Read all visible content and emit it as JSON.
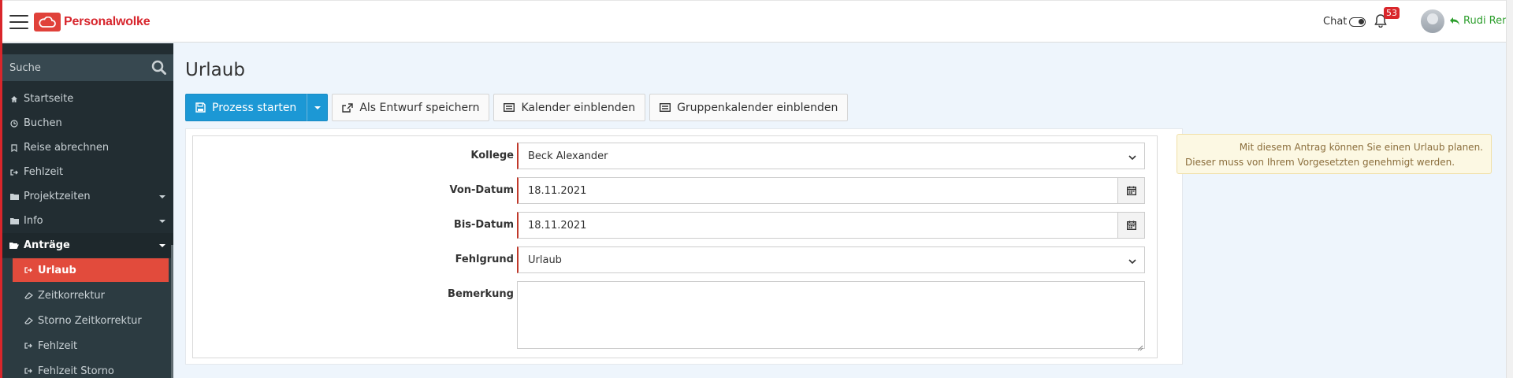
{
  "header": {
    "brand": "Personalwolke",
    "chat_label": "Chat",
    "notification_count": "53",
    "user_name": "Rudi Renner"
  },
  "sidebar": {
    "search_placeholder": "Suche",
    "items": [
      {
        "label": "Startseite",
        "icon": "home-icon"
      },
      {
        "label": "Buchen",
        "icon": "clock-icon"
      },
      {
        "label": "Reise abrechnen",
        "icon": "bookmark-icon"
      },
      {
        "label": "Fehlzeit",
        "icon": "sign-out-icon"
      },
      {
        "label": "Projektzeiten",
        "icon": "folder-icon"
      },
      {
        "label": "Info",
        "icon": "folder-icon"
      },
      {
        "label": "Anträge",
        "icon": "folder-open-icon"
      }
    ],
    "subitems": [
      {
        "label": "Urlaub",
        "icon": "sign-out-icon"
      },
      {
        "label": "Zeitkorrektur",
        "icon": "eraser-icon"
      },
      {
        "label": "Storno Zeitkorrektur",
        "icon": "eraser-icon"
      },
      {
        "label": "Fehlzeit",
        "icon": "sign-out-icon"
      },
      {
        "label": "Fehlzeit Storno",
        "icon": "sign-out-icon"
      }
    ]
  },
  "main": {
    "title": "Urlaub",
    "toolbar": {
      "start_label": "Prozess starten",
      "draft_label": "Als Entwurf speichern",
      "calendar_label": "Kalender einblenden",
      "group_calendar_label": "Gruppenkalender einblenden"
    },
    "form": {
      "colleague_label": "Kollege",
      "colleague_value": "Beck Alexander",
      "from_label": "Von-Datum",
      "from_value": "18.11.2021",
      "to_label": "Bis-Datum",
      "to_value": "18.11.2021",
      "reason_label": "Fehlgrund",
      "reason_value": "Urlaub",
      "remark_label": "Bemerkung",
      "remark_value": ""
    },
    "info": {
      "line1": "Mit diesem Antrag können Sie einen Urlaub planen.",
      "line2": "Dieser muss von Ihrem Vorgesetzten genehmigt werden."
    }
  },
  "colors": {
    "brand_red": "#d7262d",
    "primary_blue": "#1c98d5",
    "sidebar_bg": "#222d32",
    "active_item": "#e24b3c",
    "user_green": "#2c9e2c"
  }
}
